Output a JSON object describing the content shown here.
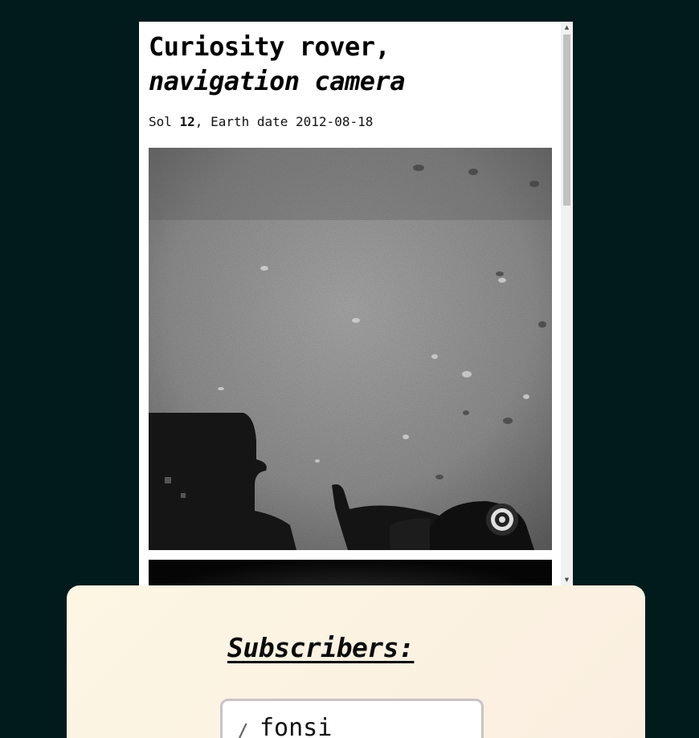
{
  "article": {
    "title_line1": "Curiosity rover,",
    "title_line2": "navigation camera",
    "sol_label": "Sol ",
    "sol_value": "12",
    "earth_date_text": ", Earth date 2012-08-18"
  },
  "photos": [
    {
      "icon": "mars-surface-photo"
    },
    {
      "icon": "dark-photo"
    }
  ],
  "scrollbar": {
    "up_glyph": "▲",
    "down_glyph": "▼"
  },
  "subscribers": {
    "heading": "Subscribers:",
    "items": [
      {
        "prefix": "/",
        "name": "fonsi"
      }
    ]
  },
  "colors": {
    "page_background": "#011b1c",
    "card_background": "#fdf6e3",
    "subscriber_border": "#c9c4c4"
  }
}
